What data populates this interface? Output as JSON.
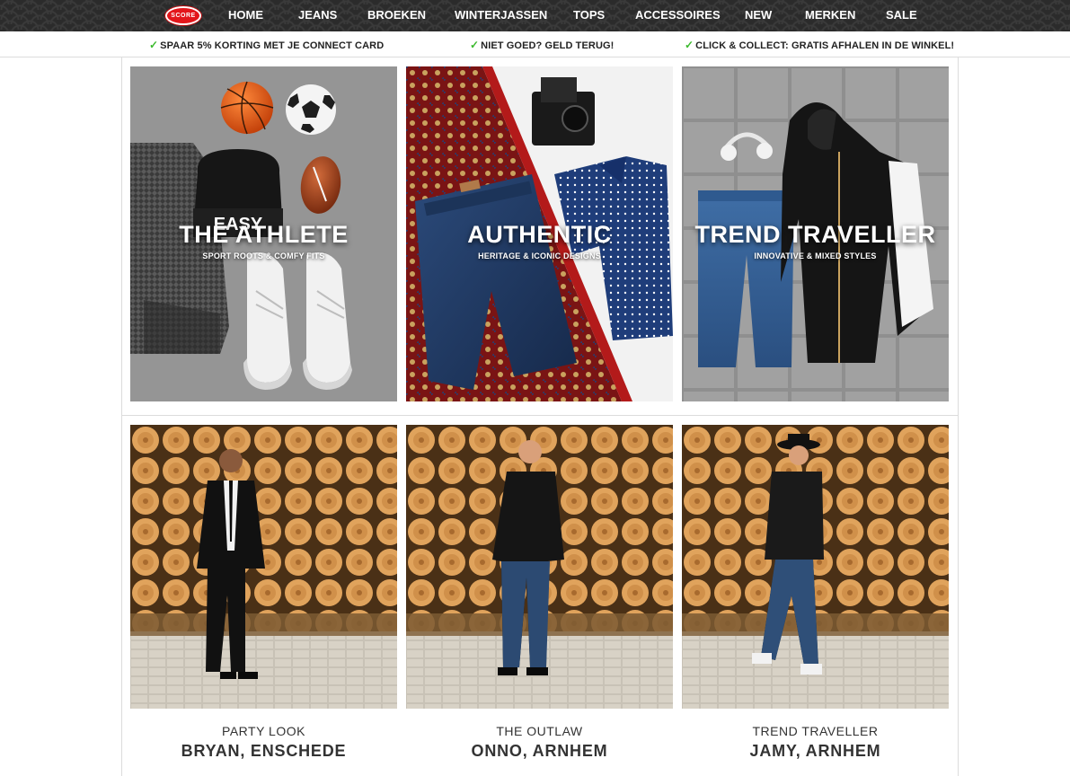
{
  "logo_text": "SCORE",
  "nav": [
    {
      "label": "HOME"
    },
    {
      "label": "JEANS"
    },
    {
      "label": "BROEKEN"
    },
    {
      "label": "WINTERJASSEN"
    },
    {
      "label": "TOPS"
    },
    {
      "label": "ACCESSOIRES"
    },
    {
      "label": "NEW"
    },
    {
      "label": "MERKEN"
    },
    {
      "label": "SALE"
    }
  ],
  "usps": [
    {
      "check": "✓",
      "text": "SPAAR 5% KORTING MET JE CONNECT CARD"
    },
    {
      "check": "✓",
      "text": "NIET GOED? GELD TERUG!"
    },
    {
      "check": "✓",
      "text": "CLICK & COLLECT: GRATIS AFHALEN IN DE WINKEL!"
    }
  ],
  "categories": [
    {
      "title": "THE ATHLETE",
      "subtitle": "SPORT ROOTS & COMFY FITS",
      "beanie_text": "EASY"
    },
    {
      "title": "AUTHENTIC",
      "subtitle": "HERITAGE & ICONIC DESIGNS"
    },
    {
      "title": "TREND TRAVELLER",
      "subtitle": "INNOVATIVE & MIXED STYLES"
    }
  ],
  "looks": [
    {
      "label": "PARTY LOOK",
      "name": "BRYAN, ENSCHEDE"
    },
    {
      "label": "THE OUTLAW",
      "name": "ONNO, ARNHEM"
    },
    {
      "label": "TREND TRAVELLER",
      "name": "JAMY, ARNHEM"
    }
  ],
  "colors": {
    "nav_bg": "#2b2b2b",
    "logo_red": "#e3161b",
    "check_green": "#3cba2e",
    "border": "#dcdcdc"
  }
}
